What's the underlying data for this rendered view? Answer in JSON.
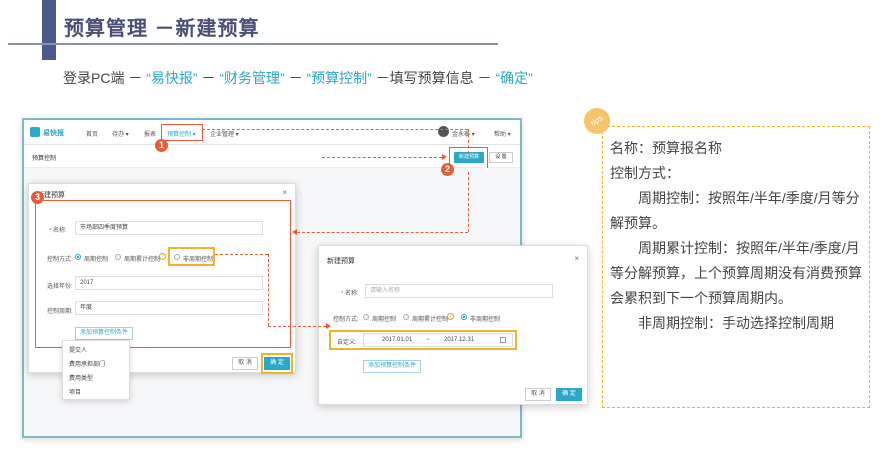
{
  "header": {
    "title": "预算管理 －新建预算",
    "breadcrumb": {
      "p1": "登录PC端 －",
      "h1": "“易快报”",
      "s1": "－",
      "h2": "“财务管理”",
      "s2": "－",
      "h3": "“预算控制”",
      "p2": "－填写预算信息 －",
      "h4": "“确定”"
    }
  },
  "app": {
    "logo": "易快报",
    "nav": [
      "首页",
      "待办 ▾",
      "报表",
      "预算控制 ▾",
      "企业管理 ▾"
    ],
    "user": "金永泰 ▾",
    "help": "帮助 ▾",
    "page_title": "预算控制",
    "new_budget_button": "新建预算",
    "settings_button": "设 置"
  },
  "dialog1": {
    "title": "新建预算",
    "close": "×",
    "name_label": "名称:",
    "name_value": "市场部四季度预算",
    "control_label": "控制方式:",
    "opt_periodic": "周期控制",
    "opt_cumulative": "周期累计控制",
    "opt_nonperiodic": "非周期控制",
    "year_label": "选择年份:",
    "year_value": "2017",
    "cycle_label": "控制周期:",
    "cycle_value": "年度",
    "add_condition": "添加预算控制条件",
    "dropdown": [
      "提交人",
      "费用承担部门",
      "费用类型",
      "项目"
    ],
    "cancel": "取 消",
    "ok": "确 定"
  },
  "dialog2": {
    "title": "新建预算",
    "close": "×",
    "name_label": "名称:",
    "name_placeholder": "请输入名称",
    "control_label": "控制方式:",
    "opt_periodic": "周期控制",
    "opt_cumulative": "周期累计控制",
    "opt_nonperiodic": "非周期控制",
    "custom_label": "自定义:",
    "date_start": "2017.01.01",
    "date_sep": "~",
    "date_end": "2017.12.31",
    "add_condition": "添加预算控制条件",
    "cancel": "取 消",
    "ok": "确 定"
  },
  "markers": [
    "1",
    "2",
    "3"
  ],
  "tips": {
    "badge": "tips",
    "line1": "名称：预算报名称",
    "line2": "控制方式：",
    "line3": "周期控制：按照年/半年/季度/月等分解预算。",
    "line4": "周期累计控制：按照年/半年/季度/月等分解预算，上个预算周期没有消费预算会累积到下一个预算周期内。",
    "line5": "非周期控制：手动选择控制周期"
  }
}
